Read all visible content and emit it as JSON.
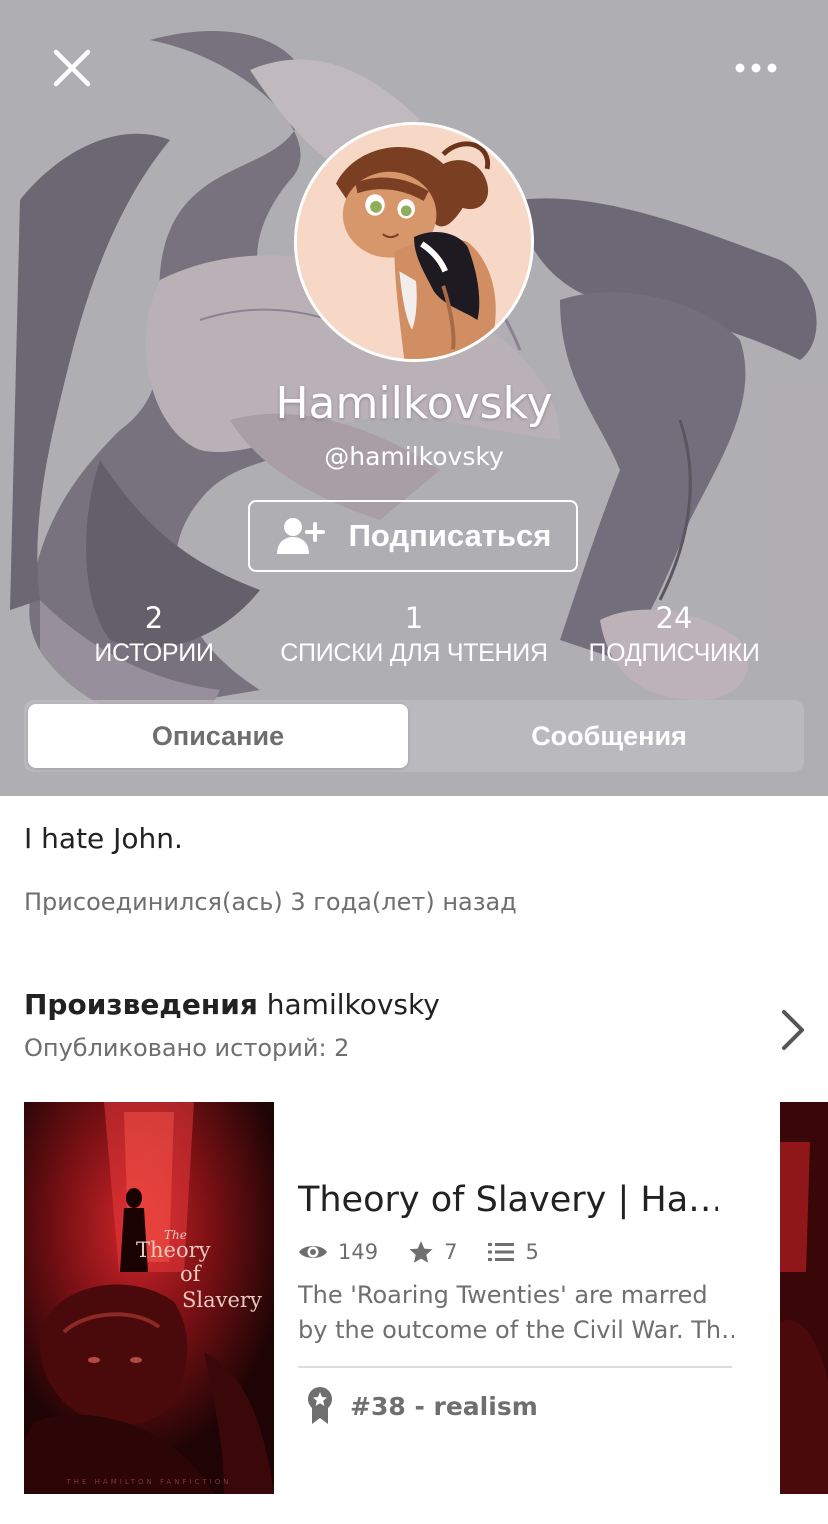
{
  "header": {
    "close_icon": "close-icon",
    "more_icon": "more-horizontal-icon",
    "display_name": "Hamilkovsky",
    "username": "@hamilkovsky",
    "follow_label": "Подписаться",
    "follow_icon": "add-user-icon"
  },
  "stats": [
    {
      "value": "2",
      "label": "ИСТОРИИ"
    },
    {
      "value": "1",
      "label": "СПИСКИ ДЛЯ ЧТЕНИЯ"
    },
    {
      "value": "24",
      "label": "ПОДПИСЧИКИ"
    }
  ],
  "tabs": [
    {
      "label": "Описание",
      "active": true
    },
    {
      "label": "Сообщения",
      "active": false
    }
  ],
  "about": {
    "bio": "I hate John.",
    "joined": "Присоединился(ась) 3 года(лет) назад"
  },
  "works": {
    "title_bold": "Произведения",
    "title_user": "hamilkovsky",
    "count_text": "Опубликовано историй: 2"
  },
  "story": {
    "title": "Theory of Slavery | Ha…",
    "reads": "149",
    "votes": "7",
    "parts": "5",
    "description_lines": [
      "The 'Roaring Twenties' are marred",
      "by the outcome of the Civil War. Th…"
    ],
    "tag": "#38 - realism",
    "cover": {
      "the": "The",
      "theory": "Theory",
      "of": "of",
      "slavery": "Slavery",
      "footer": "THE HAMILTON FANFICTION"
    }
  },
  "colors": {
    "header_bg": "#a9a7ad",
    "text_primary": "#222222",
    "text_secondary": "#6f6f6f",
    "cover_red": "#8c1216"
  }
}
